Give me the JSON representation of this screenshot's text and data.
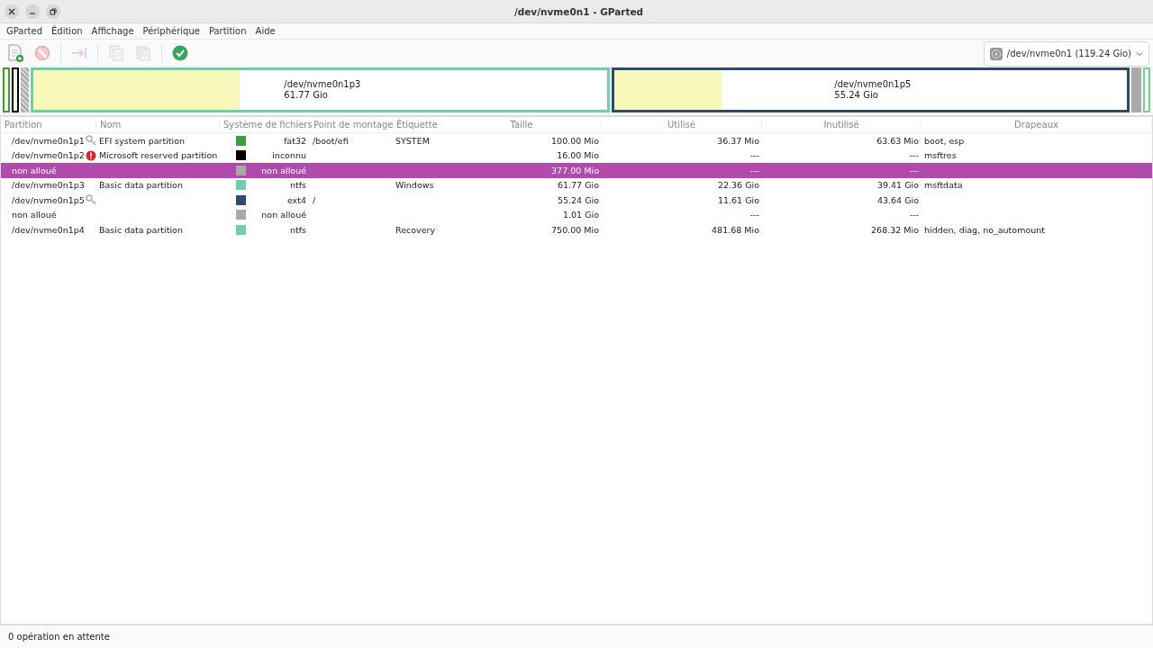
{
  "window": {
    "title": "/dev/nvme0n1 - GParted"
  },
  "menu": [
    "GParted",
    "Édition",
    "Affichage",
    "Périphérique",
    "Partition",
    "Aide"
  ],
  "toolbar": [
    {
      "kind": "new",
      "disabled": false
    },
    {
      "kind": "delete",
      "disabled": true
    },
    {
      "kind": "sep"
    },
    {
      "kind": "resize",
      "disabled": true
    },
    {
      "kind": "sep"
    },
    {
      "kind": "copy",
      "disabled": true
    },
    {
      "kind": "paste",
      "disabled": true
    },
    {
      "kind": "sep"
    },
    {
      "kind": "apply",
      "disabled": false
    }
  ],
  "device_selector": {
    "value": "/dev/nvme0n1 (119.24 Gio)"
  },
  "disk_map": [
    {
      "kind": "tiny",
      "color": "#3c9e3c"
    },
    {
      "kind": "tiny",
      "color": "#000000"
    },
    {
      "kind": "unallocated",
      "color": "#a9a9a9"
    },
    {
      "kind": "wide",
      "color": "#6fcfad",
      "name": "/dev/nvme0n1p3",
      "size": "61.77 Gio",
      "level": 0.36
    },
    {
      "kind": "wide",
      "color": "#2f4b6b",
      "name": "/dev/nvme0n1p5",
      "size": "55.24 Gio",
      "level": 0.21
    },
    {
      "kind": "gap",
      "color": "#a9a9a9"
    },
    {
      "kind": "tiny",
      "color": "#6fcfad"
    }
  ],
  "table": {
    "columns": [
      "Partition",
      "Nom",
      "Système de fichiers",
      "Point de montage",
      "Étiquette",
      "Taille",
      "Utilisé",
      "Inutilisé",
      "Drapeaux"
    ],
    "rows": [
      {
        "partition": "/dev/nvme0n1p1",
        "mounted": true,
        "warning": false,
        "name": "EFI system partition",
        "color": "#3c9e3c",
        "filesystem": "fat32",
        "mount": "/boot/efi",
        "label": "SYSTEM",
        "size": "100.00 Mio",
        "used": "36.37 Mio",
        "unused": "63.63 Mio",
        "flags": "boot, esp",
        "selected": false
      },
      {
        "partition": "/dev/nvme0n1p2",
        "mounted": false,
        "warning": true,
        "name": "Microsoft reserved partition",
        "color": "#000000",
        "filesystem": "inconnu",
        "mount": "",
        "label": "",
        "size": "16.00 Mio",
        "used": "---",
        "unused": "---",
        "flags": "msftres",
        "selected": false
      },
      {
        "partition": "non alloué",
        "mounted": false,
        "warning": false,
        "name": "",
        "color": "#a9a9a9",
        "filesystem": "non alloué",
        "mount": "",
        "label": "",
        "size": "377.00 Mio",
        "used": "---",
        "unused": "---",
        "flags": "",
        "selected": true
      },
      {
        "partition": "/dev/nvme0n1p3",
        "mounted": false,
        "warning": false,
        "name": "Basic data partition",
        "color": "#6fcfad",
        "filesystem": "ntfs",
        "mount": "",
        "label": "Windows",
        "size": "61.77 Gio",
        "used": "22.36 Gio",
        "unused": "39.41 Gio",
        "flags": "msftdata",
        "selected": false
      },
      {
        "partition": "/dev/nvme0n1p5",
        "mounted": true,
        "warning": false,
        "name": "",
        "color": "#2f4b6b",
        "filesystem": "ext4",
        "mount": "/",
        "label": "",
        "size": "55.24 Gio",
        "used": "11.61 Gio",
        "unused": "43.64 Gio",
        "flags": "",
        "selected": false
      },
      {
        "partition": "non alloué",
        "mounted": false,
        "warning": false,
        "name": "",
        "color": "#a9a9a9",
        "filesystem": "non alloué",
        "mount": "",
        "label": "",
        "size": "1.01 Gio",
        "used": "---",
        "unused": "---",
        "flags": "",
        "selected": false
      },
      {
        "partition": "/dev/nvme0n1p4",
        "mounted": false,
        "warning": false,
        "name": "Basic data partition",
        "color": "#6fcfad",
        "filesystem": "ntfs",
        "mount": "",
        "label": "Recovery",
        "size": "750.00 Mio",
        "used": "481.68 Mio",
        "unused": "268.32 Mio",
        "flags": "hidden, diag, no_automount",
        "selected": false
      }
    ]
  },
  "status_bar": "0 opération en attente"
}
